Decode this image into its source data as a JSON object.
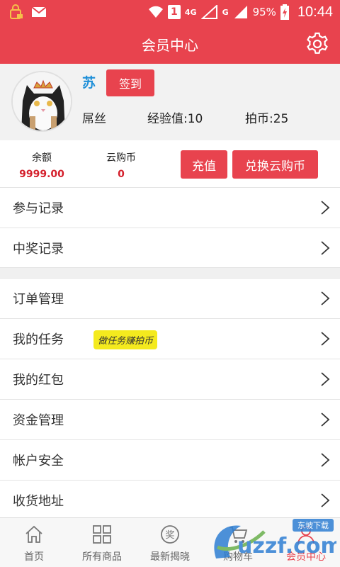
{
  "status_bar": {
    "mobile_label": "4G",
    "g_label": "G",
    "sim_number": "1",
    "battery": "95%",
    "time": "10:44"
  },
  "header": {
    "title": "会员中心"
  },
  "profile": {
    "username": "苏",
    "signin_label": "签到",
    "level": "屌丝",
    "experience": "经验值:10",
    "coins": "拍币:25"
  },
  "balance": {
    "balance_label": "余额",
    "balance_value": "9999.00",
    "cloud_label": "云购币",
    "cloud_value": "0",
    "recharge_label": "充值",
    "exchange_label": "兑换云购币"
  },
  "menu": {
    "group1": [
      "参与记录",
      "中奖记录"
    ],
    "group2": [
      "订单管理",
      "我的任务",
      "我的红包",
      "资金管理",
      "帐户安全",
      "收货地址"
    ],
    "task_badge": "做任务赚拍币"
  },
  "bottom_nav": [
    {
      "label": "首页",
      "icon": "home-icon"
    },
    {
      "label": "所有商品",
      "icon": "grid-icon"
    },
    {
      "label": "最新揭晓",
      "icon": "prize-icon"
    },
    {
      "label": "购物车",
      "icon": "cart-icon"
    },
    {
      "label": "会员中心",
      "icon": "user-icon"
    }
  ],
  "watermark": {
    "text": "uzzf.com",
    "tag": "东坡下载"
  },
  "colors": {
    "accent": "#e8434e",
    "link": "#1e8fd8",
    "badge": "#f4ea1e"
  }
}
